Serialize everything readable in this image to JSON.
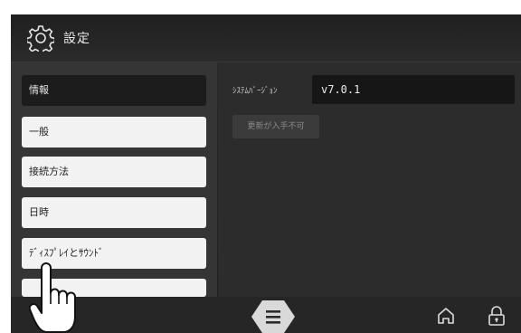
{
  "header": {
    "title": "設定",
    "icon": "gear-icon"
  },
  "sidebar": {
    "items": [
      {
        "label": "情報",
        "active": true
      },
      {
        "label": "一般",
        "active": false
      },
      {
        "label": "接続方法",
        "active": false
      },
      {
        "label": "日時",
        "active": false
      },
      {
        "label": "ﾃﾞｨｽﾌﾟﾚｲとｻｳﾝﾄﾞ",
        "active": false
      }
    ]
  },
  "main": {
    "version_label": "ｼｽﾃﾑﾊﾞｰｼﾞｮﾝ",
    "version_value": "v7.0.1",
    "update_button": "更新が入手不可"
  },
  "footer": {
    "icons": [
      "menu-icon",
      "home-icon",
      "lock-icon"
    ]
  },
  "overlay": {
    "icon": "pointing-hand-icon"
  },
  "colors": {
    "item_bg": "#f2f2f2",
    "active_bg": "#1c1c1c",
    "panel_bg": "#2c2c2c"
  }
}
